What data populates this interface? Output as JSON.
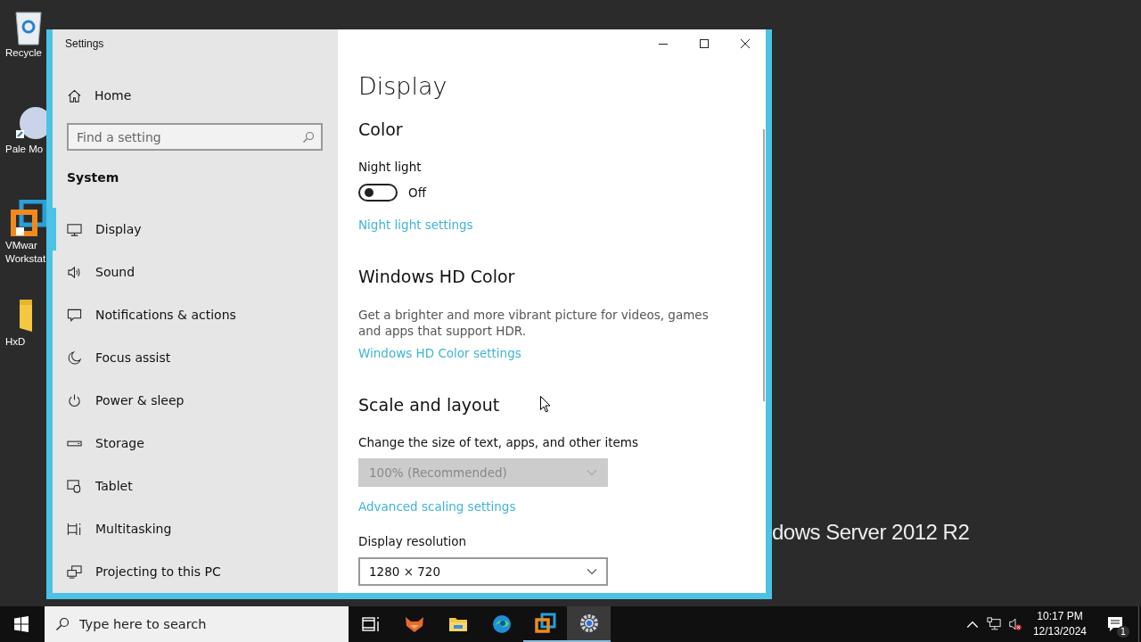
{
  "desktop": {
    "icons": [
      {
        "kind": "recycle-bin",
        "label": [
          "Recycle"
        ]
      },
      {
        "kind": "moon-globe",
        "label": [
          "Pale Mo"
        ]
      },
      {
        "kind": "vm-logo",
        "label": [
          "VMwar",
          "Workstat"
        ]
      },
      {
        "kind": "folder",
        "label": [
          "HxD"
        ]
      }
    ],
    "branding": "dows Server 2012 R2"
  },
  "window": {
    "title": "Settings"
  },
  "sidebar": {
    "home": "Home",
    "search": {
      "placeholder": "Find a setting"
    },
    "section": "System",
    "items": [
      {
        "label": "Display",
        "kind": "display",
        "selected": true
      },
      {
        "label": "Sound",
        "kind": "sound",
        "selected": false
      },
      {
        "label": "Notifications & actions",
        "kind": "notifications",
        "selected": false
      },
      {
        "label": "Focus assist",
        "kind": "moon",
        "selected": false
      },
      {
        "label": "Power & sleep",
        "kind": "power",
        "selected": false
      },
      {
        "label": "Storage",
        "kind": "storage",
        "selected": false
      },
      {
        "label": "Tablet",
        "kind": "tablet",
        "selected": false
      },
      {
        "label": "Multitasking",
        "kind": "multitasking",
        "selected": false
      },
      {
        "label": "Projecting to this PC",
        "kind": "projecting",
        "selected": false
      }
    ]
  },
  "content": {
    "title": "Display",
    "items": [
      {
        "kind": "heading",
        "text": "Color"
      },
      {
        "kind": "label",
        "text": "Night light"
      },
      {
        "kind": "toggle",
        "on": false,
        "state_text": "Off"
      },
      {
        "kind": "link",
        "text": "Night light settings"
      },
      {
        "kind": "heading",
        "text": "Windows HD Color"
      },
      {
        "kind": "text",
        "text": "Get a brighter and more vibrant picture for videos, games and apps that support HDR."
      },
      {
        "kind": "link",
        "text": "Windows HD Color settings"
      },
      {
        "kind": "heading",
        "text": "Scale and layout"
      },
      {
        "kind": "label",
        "text": "Change the size of text, apps, and other items"
      },
      {
        "kind": "dropdown",
        "value": "100% (Recommended)",
        "disabled": true
      },
      {
        "kind": "link",
        "text": "Advanced scaling settings"
      },
      {
        "kind": "label",
        "text": "Display resolution"
      },
      {
        "kind": "dropdown",
        "value": "1280 × 720",
        "disabled": false
      }
    ]
  },
  "taskbar": {
    "search": {
      "placeholder": "Type here to search"
    },
    "apps": [
      {
        "kind": "task-view",
        "running": false,
        "selected": false
      },
      {
        "kind": "fox",
        "running": false,
        "selected": false
      },
      {
        "kind": "folder",
        "running": false,
        "selected": false
      },
      {
        "kind": "browser",
        "running": false,
        "selected": false
      },
      {
        "kind": "vm",
        "running": true,
        "selected": false
      },
      {
        "kind": "gear",
        "running": true,
        "selected": true
      }
    ],
    "tray": {
      "time": "10:17 PM",
      "date": "12/13/2024",
      "notification_count": "1"
    }
  }
}
